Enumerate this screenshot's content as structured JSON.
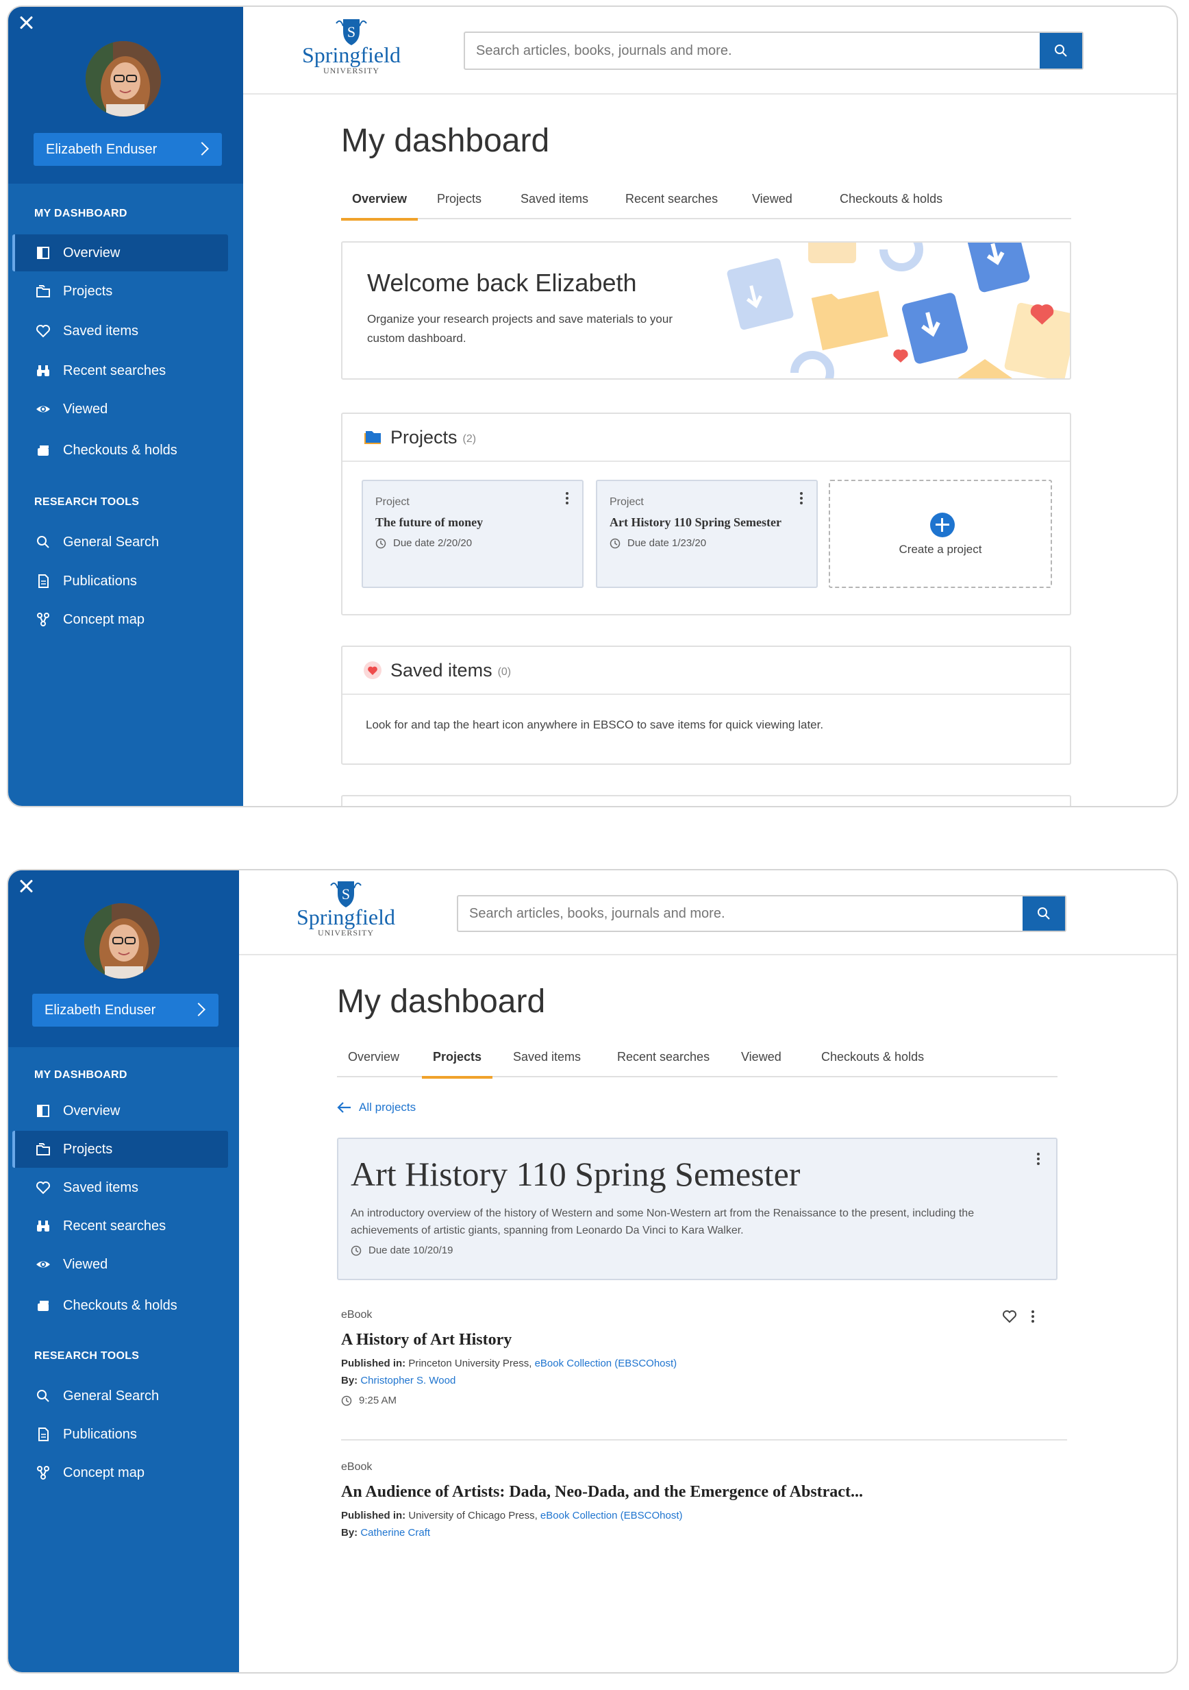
{
  "screen1": {
    "sidebar": {
      "user_name": "Elizabeth Enduser",
      "section_dashboard": "MY DASHBOARD",
      "dashboard_items": [
        "Overview",
        "Projects",
        "Saved items",
        "Recent searches",
        "Viewed",
        "Checkouts & holds"
      ],
      "section_tools": "RESEARCH TOOLS",
      "tool_items": [
        "General Search",
        "Publications",
        "Concept map"
      ],
      "active": "Overview"
    },
    "logo": {
      "name": "Springfield",
      "sub": "UNIVERSITY"
    },
    "search": {
      "placeholder": "Search articles, books, journals and more."
    },
    "page_title": "My dashboard",
    "tabs": [
      "Overview",
      "Projects",
      "Saved items",
      "Recent searches",
      "Viewed",
      "Checkouts & holds"
    ],
    "active_tab": "Overview",
    "welcome": {
      "title": "Welcome back Elizabeth",
      "text": "Organize your research projects and save materials to your custom dashboard."
    },
    "projects": {
      "title": "Projects",
      "count": "(2)",
      "cards": [
        {
          "label": "Project",
          "title": "The future of money",
          "due": "Due date 2/20/20"
        },
        {
          "label": "Project",
          "title": "Art History 110 Spring Semester",
          "due": "Due date 1/23/20"
        }
      ],
      "create_label": "Create a project"
    },
    "saved": {
      "title": "Saved items",
      "count": "(0)",
      "text": "Look for and tap the heart icon anywhere in EBSCO to save items for quick viewing later."
    }
  },
  "screen2": {
    "sidebar": {
      "user_name": "Elizabeth Enduser",
      "section_dashboard": "MY DASHBOARD",
      "dashboard_items": [
        "Overview",
        "Projects",
        "Saved items",
        "Recent searches",
        "Viewed",
        "Checkouts & holds"
      ],
      "section_tools": "RESEARCH TOOLS",
      "tool_items": [
        "General Search",
        "Publications",
        "Concept map"
      ],
      "active": "Projects"
    },
    "logo": {
      "name": "Springfield",
      "sub": "UNIVERSITY"
    },
    "search": {
      "placeholder": "Search articles, books, journals and more."
    },
    "page_title": "My dashboard",
    "tabs": [
      "Overview",
      "Projects",
      "Saved items",
      "Recent searches",
      "Viewed",
      "Checkouts & holds"
    ],
    "active_tab": "Projects",
    "back_link": "All projects",
    "project": {
      "title": "Art History 110 Spring Semester",
      "description": "An introductory overview of the history of Western and some Non-Western art from the Renaissance to the present, including the achievements of artistic giants, spanning from Leonardo Da Vinci to Kara Walker.",
      "due": "Due date 10/20/19"
    },
    "items": [
      {
        "type": "eBook",
        "title": "A History of Art History",
        "published_label": "Published in:",
        "publisher": "Princeton University Press,",
        "collection": "eBook Collection (EBSCOhost)",
        "by_label": "By:",
        "author": "Christopher S. Wood",
        "time": "9:25 AM"
      },
      {
        "type": "eBook",
        "title": "An Audience of Artists: Dada, Neo-Dada, and the Emergence of Abstract...",
        "published_label": "Published in:",
        "publisher": "University  of Chicago Press,",
        "collection": "eBook Collection (EBSCOhost)",
        "by_label": "By:",
        "author": "Catherine Craft"
      }
    ]
  },
  "colors": {
    "sidebar": "#1565b0",
    "sidebar_head": "#0d559f",
    "accent": "#f0a22b",
    "link": "#1e74cf"
  }
}
